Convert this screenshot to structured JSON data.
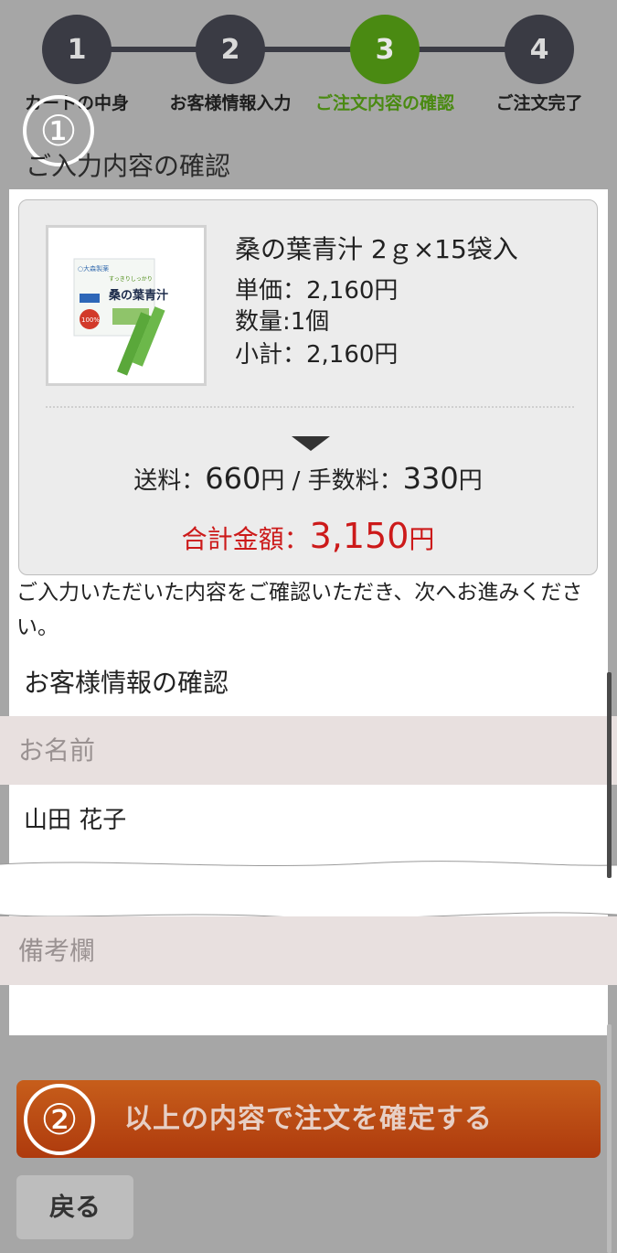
{
  "steps": [
    {
      "number": "1",
      "label": "カートの中身",
      "active": false
    },
    {
      "number": "2",
      "label": "お客様情報入力",
      "active": false
    },
    {
      "number": "3",
      "label": "ご注文内容の確認",
      "active": true
    },
    {
      "number": "4",
      "label": "ご注文完了",
      "active": false
    }
  ],
  "markers": {
    "one": "①",
    "two": "②"
  },
  "section_title": "ご入力内容の確認",
  "product": {
    "image_text": {
      "brand": "○大森製薬",
      "catch": "すっきりしっかり",
      "name": "桑の葉青汁",
      "badge": "100%"
    },
    "name": "桑の葉青汁 2ｇ×15袋入",
    "unit_price": "単価：2,160円",
    "quantity": "数量:1個",
    "subtotal": "小計：2,160円"
  },
  "fees": {
    "shipping_label": "送料：",
    "shipping_value": "660",
    "yen1": "円",
    "separator": " / ",
    "handling_label": "手数料：",
    "handling_value": "330",
    "yen2": "円"
  },
  "total": {
    "label": "合計金額：",
    "value": "3,150",
    "yen": "円"
  },
  "note": "ご入力いただいた内容をご確認いただき、次へお進みください。",
  "customer_section_title": "お客様情報の確認",
  "fields": {
    "name_label": "お名前",
    "name_value": "山田 花子",
    "remarks_label": "備考欄"
  },
  "buttons": {
    "confirm": "以上の内容で注文を確定する",
    "back": "戻る"
  },
  "colors": {
    "active_step": "#4a8a12",
    "step": "#3a3b44",
    "total": "#cc1a1a",
    "confirm_button": "#b9461a"
  }
}
